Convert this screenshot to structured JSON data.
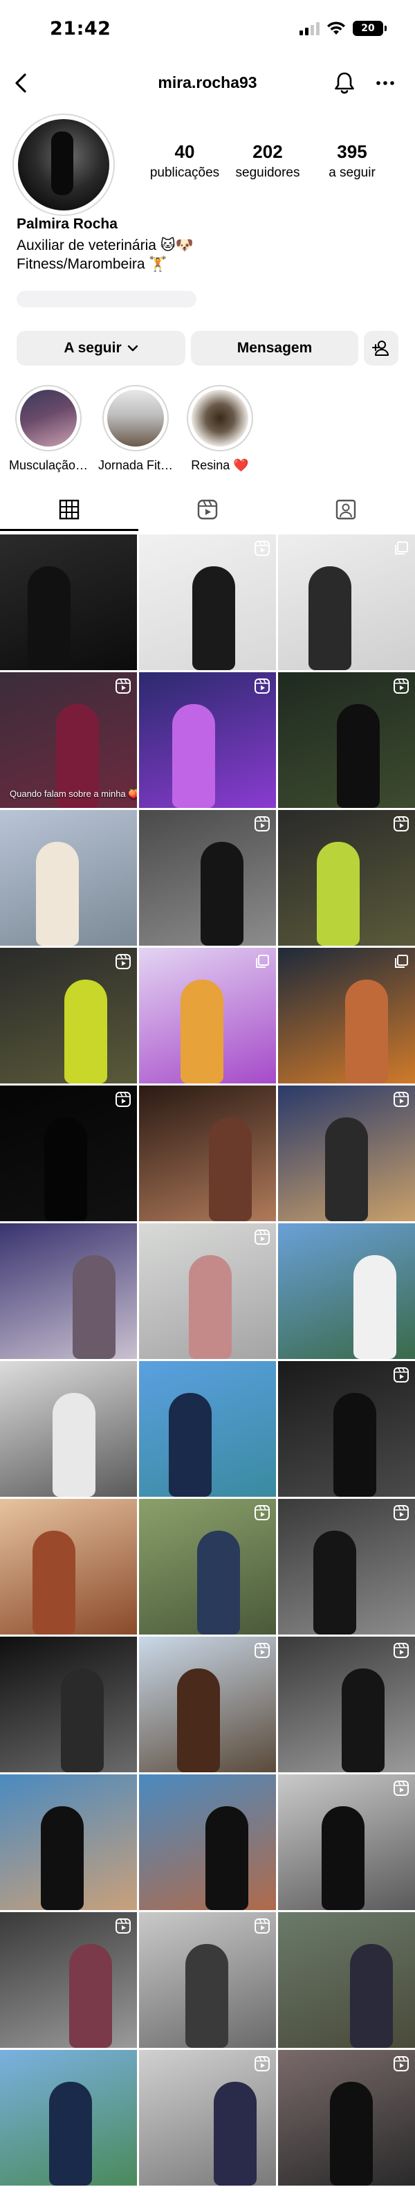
{
  "status_bar": {
    "time": "21:42",
    "battery_level": "20",
    "icons": [
      "signal-icon",
      "wifi-icon",
      "battery-icon"
    ]
  },
  "header": {
    "username": "mira.rocha93",
    "icons": [
      "back-arrow-icon",
      "bell-icon",
      "more-dots-icon"
    ]
  },
  "profile": {
    "display_name": "Palmira Rocha",
    "bio": [
      "Auxiliar de veterinária 🐱🐶",
      "Fitness/Marombeira 🏋️"
    ],
    "stats": [
      {
        "value": "40",
        "label": "publicações"
      },
      {
        "value": "202",
        "label": "seguidores"
      },
      {
        "value": "395",
        "label": "a seguir"
      }
    ]
  },
  "actions": {
    "following_label": "A seguir",
    "message_label": "Mensagem"
  },
  "highlights": [
    {
      "label": "Musculação…"
    },
    {
      "label": "Jornada Fit…"
    },
    {
      "label": "Resina ❤️"
    }
  ],
  "tabs": [
    "grid-icon",
    "reels-icon",
    "tagged-icon"
  ],
  "colors": {
    "text": "#000000",
    "button_bg": "#efefef",
    "border": "#dbdbdb"
  },
  "grid": {
    "caption": "Quando falam sobre a minha 🍑",
    "tiles": [
      {
        "c1": "#2b2b2b",
        "c2": "#0c0c0c",
        "badge": "none",
        "fig": "#111111"
      },
      {
        "c1": "#f1f1f1",
        "c2": "#d8d8d8",
        "badge": "reel",
        "fig": "#1a1a1a"
      },
      {
        "c1": "#eeeeee",
        "c2": "#cfcfcf",
        "badge": "carousel",
        "fig": "#2a2a2a"
      },
      {
        "c1": "#3b2d3a",
        "c2": "#6c2a3f",
        "badge": "reel",
        "fig": "#7a1d3a"
      },
      {
        "c1": "#2b2a6e",
        "c2": "#8a3bd0",
        "badge": "reel",
        "fig": "#c065e6"
      },
      {
        "c1": "#1f2a20",
        "c2": "#3d4b2f",
        "badge": "reel",
        "fig": "#0f0f0f"
      },
      {
        "c1": "#b9c4d6",
        "c2": "#7b8a96",
        "badge": "none",
        "fig": "#efe6d8"
      },
      {
        "c1": "#4a4a4a",
        "c2": "#8c8c8c",
        "badge": "reel",
        "fig": "#151515"
      },
      {
        "c1": "#2a2a2a",
        "c2": "#5a5a3a",
        "badge": "reel",
        "fig": "#b9d43a"
      },
      {
        "c1": "#2a2a2a",
        "c2": "#5a5a3a",
        "badge": "reel",
        "fig": "#c9d62a"
      },
      {
        "c1": "#e3d4f2",
        "c2": "#a64ac9",
        "badge": "carousel",
        "fig": "#e8a23a"
      },
      {
        "c1": "#1e2a3a",
        "c2": "#d07a2a",
        "badge": "carousel",
        "fig": "#c06a3a"
      },
      {
        "c1": "#050505",
        "c2": "#111111",
        "badge": "reel",
        "fig": "#050505"
      },
      {
        "c1": "#2a1a14",
        "c2": "#b07a5a",
        "badge": "none",
        "fig": "#6a3a2a"
      },
      {
        "c1": "#2a3a6a",
        "c2": "#c9a06a",
        "badge": "reel",
        "fig": "#2a2a2a"
      },
      {
        "c1": "#3a3470",
        "c2": "#c9c0d0",
        "badge": "none",
        "fig": "#6a5a6a"
      },
      {
        "c1": "#d8dad8",
        "c2": "#a4a4a4",
        "badge": "reel",
        "fig": "#c48a8a"
      },
      {
        "c1": "#6aa0d8",
        "c2": "#3a6a4a",
        "badge": "none",
        "fig": "#f0f0f0"
      },
      {
        "c1": "#dcdcdc",
        "c2": "#5a5a5a",
        "badge": "none",
        "fig": "#e8e8e8"
      },
      {
        "c1": "#5aa0e0",
        "c2": "#3a8aa0",
        "badge": "none",
        "fig": "#1a2a4a"
      },
      {
        "c1": "#1a1a1a",
        "c2": "#4a4a4a",
        "badge": "reel",
        "fig": "#0f0f0f"
      },
      {
        "c1": "#e6c3a0",
        "c2": "#8a4a2a",
        "badge": "none",
        "fig": "#9a4a2a"
      },
      {
        "c1": "#8aa06a",
        "c2": "#4a5a3a",
        "badge": "reel",
        "fig": "#2a3a5a"
      },
      {
        "c1": "#3a3a3a",
        "c2": "#8a8a8a",
        "badge": "reel",
        "fig": "#151515"
      },
      {
        "c1": "#0f0f0f",
        "c2": "#6a6a6a",
        "badge": "none",
        "fig": "#2a2a2a"
      },
      {
        "c1": "#c9d8e8",
        "c2": "#5a4a3a",
        "badge": "reel",
        "fig": "#4a2a1a"
      },
      {
        "c1": "#3a3a3a",
        "c2": "#9a9a9a",
        "badge": "reel",
        "fig": "#151515"
      },
      {
        "c1": "#4a8ac0",
        "c2": "#c9a07a",
        "badge": "none",
        "fig": "#101010"
      },
      {
        "c1": "#4a8ac0",
        "c2": "#b06a4a",
        "badge": "none",
        "fig": "#101010"
      },
      {
        "c1": "#c9c9c9",
        "c2": "#5a5a5a",
        "badge": "reel",
        "fig": "#0f0f0f"
      },
      {
        "c1": "#3a3a3a",
        "c2": "#9a9a9a",
        "badge": "reel",
        "fig": "#7a3a4a"
      },
      {
        "c1": "#c9c9c9",
        "c2": "#6a6a6a",
        "badge": "reel",
        "fig": "#3a3a3a"
      },
      {
        "c1": "#6a7a6a",
        "c2": "#4a4a3a",
        "badge": "none",
        "fig": "#2a2a3a"
      },
      {
        "c1": "#7ab0e0",
        "c2": "#4a8a5a",
        "badge": "none",
        "fig": "#1a2a4a"
      },
      {
        "c1": "#d0d0d0",
        "c2": "#7a7a7a",
        "badge": "reel",
        "fig": "#2a2a4a"
      },
      {
        "c1": "#7a6a6a",
        "c2": "#2a2a2a",
        "badge": "reel",
        "fig": "#0f0f0f"
      }
    ]
  }
}
